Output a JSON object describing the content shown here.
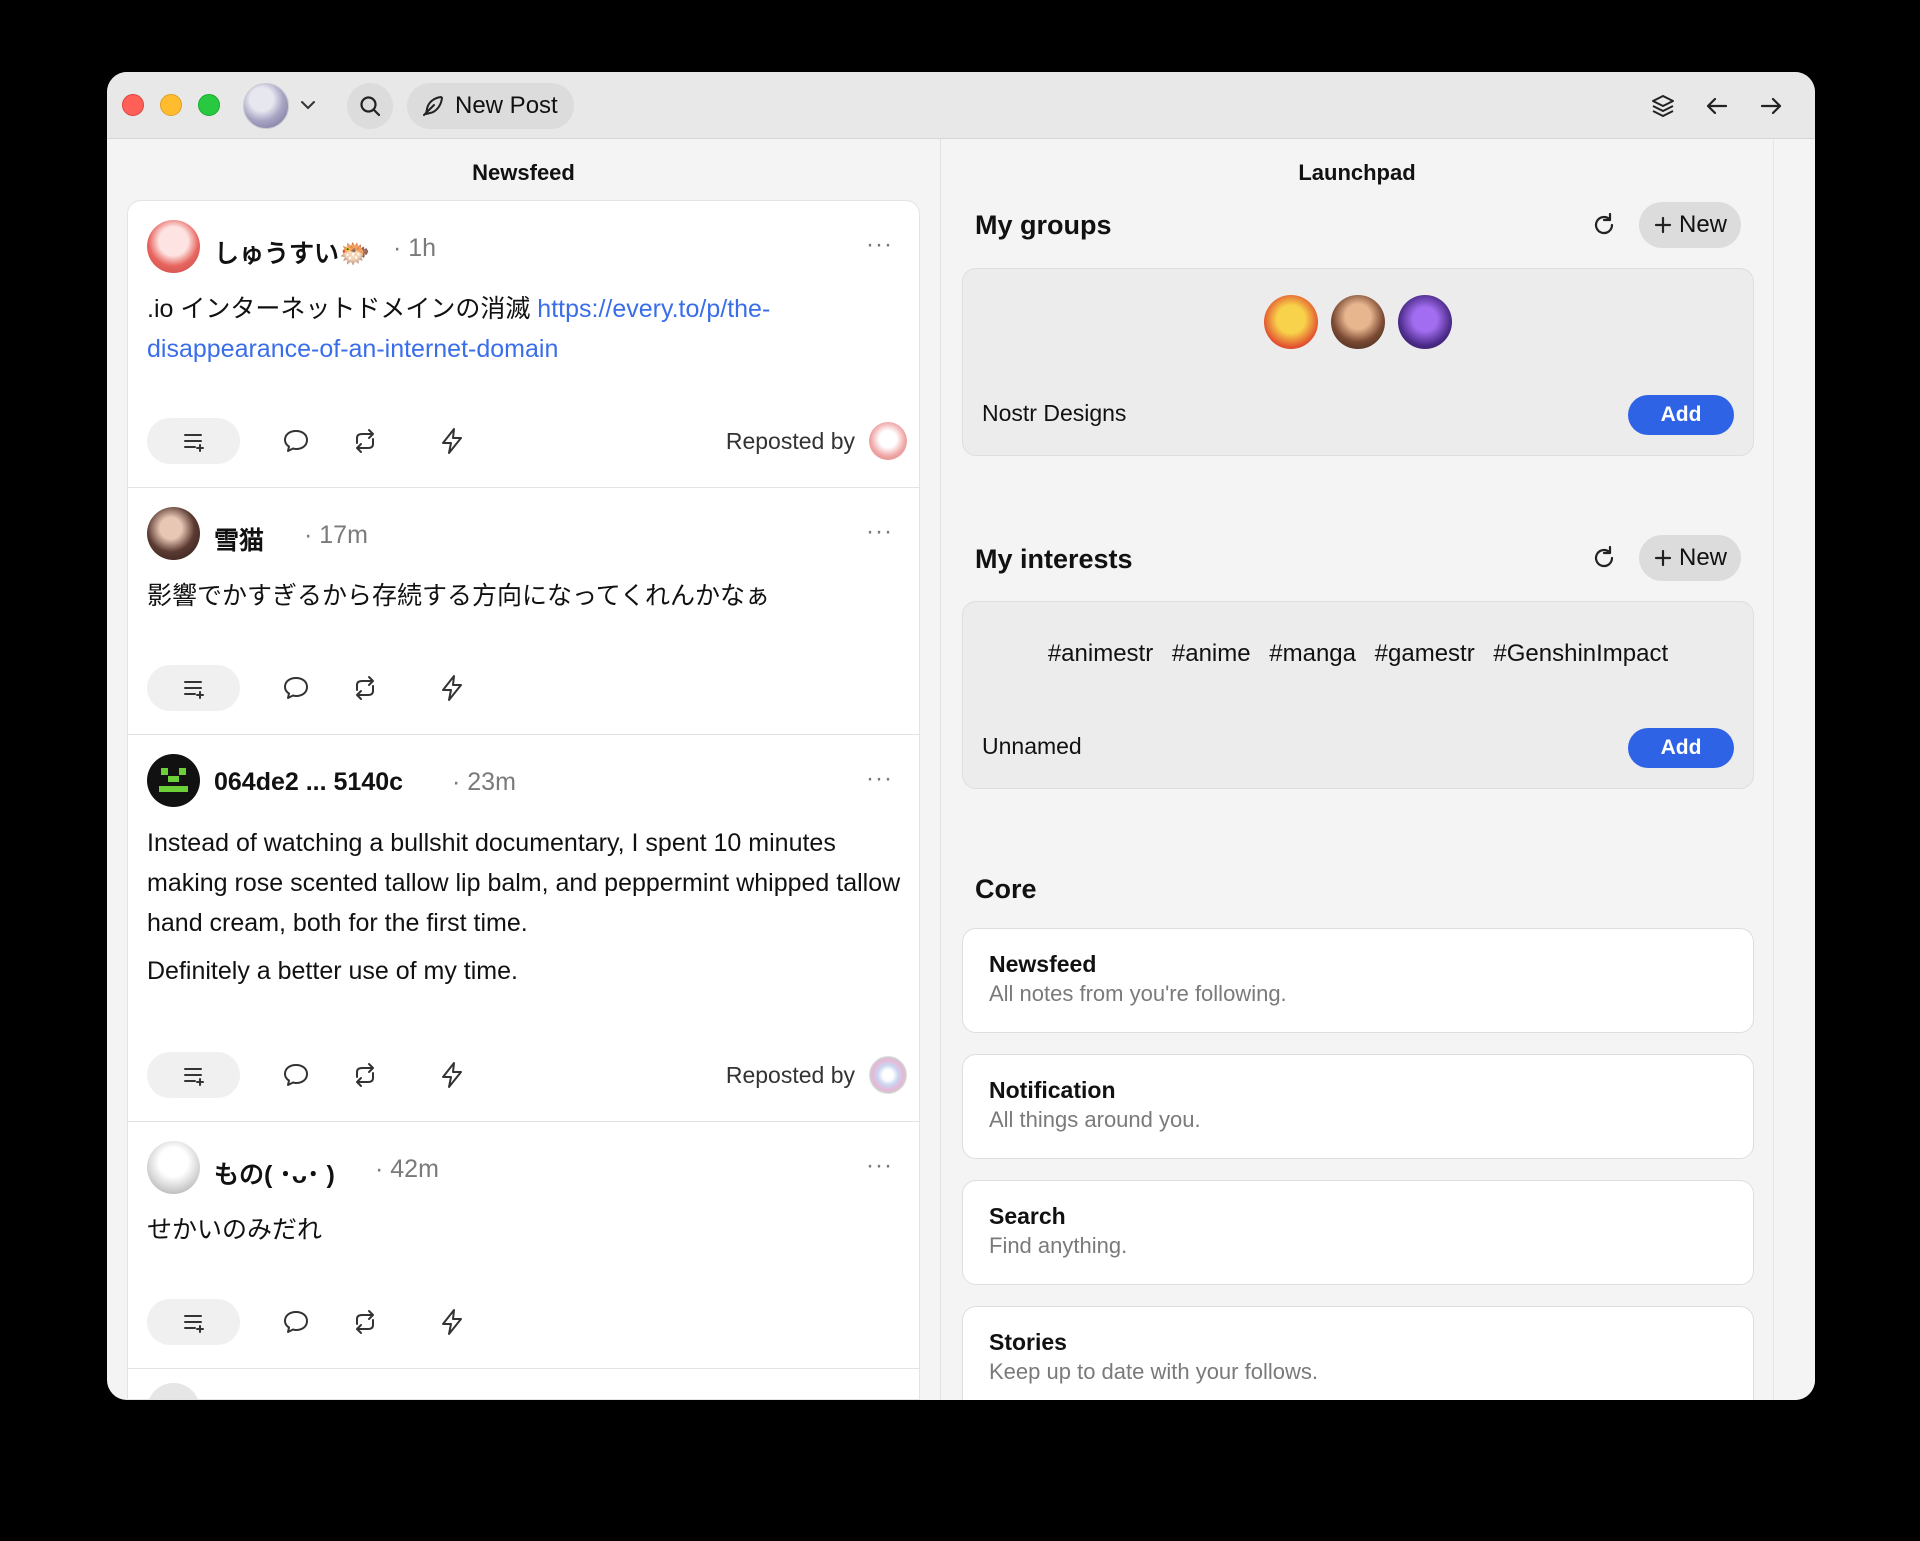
{
  "toolbar": {
    "new_post_label": "New Post"
  },
  "columns": {
    "newsfeed_title": "Newsfeed",
    "launchpad_title": "Launchpad"
  },
  "posts": [
    {
      "name": "しゅうすい🐡",
      "time": "1h",
      "body": [
        ".io インターネットドメインの消滅 "
      ],
      "link": "https://every.to/p/the-disappearance-of-an-internet-domain",
      "reposted_by": "Reposted by"
    },
    {
      "name": "雪猫",
      "time": "17m",
      "body": [
        "影響でかすぎるから存続する方向になってくれんかなぁ"
      ]
    },
    {
      "name": "064de2 ... 5140c",
      "time": "23m",
      "body": [
        "Instead of watching a bullshit documentary, I spent 10 minutes making rose scented tallow lip balm, and peppermint whipped tallow hand cream, both for the first time.",
        "Definitely a better use of my time."
      ],
      "reposted_by": "Reposted by"
    },
    {
      "name": "もの( ･ᴗ･ )",
      "time": "42m",
      "body": [
        "せかいのみだれ"
      ]
    }
  ],
  "launchpad": {
    "groups": {
      "title": "My groups",
      "new_label": "New",
      "card_name": "Nostr Designs",
      "add_label": "Add"
    },
    "interests": {
      "title": "My interests",
      "new_label": "New",
      "tags": [
        "#animestr",
        "#anime",
        "#manga",
        "#gamestr",
        "#GenshinImpact"
      ],
      "card_name": "Unnamed",
      "add_label": "Add"
    },
    "core": {
      "title": "Core",
      "items": [
        {
          "title": "Newsfeed",
          "desc": "All notes from you're following."
        },
        {
          "title": "Notification",
          "desc": "All things around you."
        },
        {
          "title": "Search",
          "desc": "Find anything."
        },
        {
          "title": "Stories",
          "desc": "Keep up to date with your follows."
        }
      ]
    }
  },
  "icons": {
    "search": "search-icon",
    "new_post": "feather-icon",
    "layers": "layers-icon",
    "back": "arrow-left-icon",
    "forward": "arrow-right-icon",
    "refresh": "refresh-icon",
    "plus": "plus-icon"
  },
  "colors": {
    "accent": "#2f63e6",
    "link": "#3a6ee8"
  }
}
